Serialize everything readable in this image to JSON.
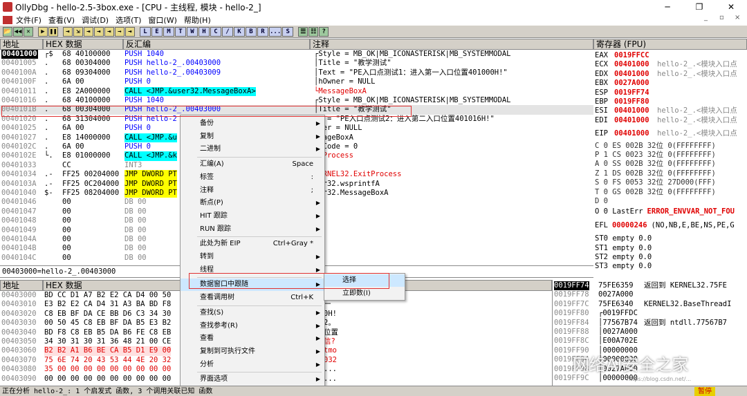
{
  "window": {
    "title": "OllyDbg - hello-2.5-3box.exe - [CPU - 主线程, 模块 - hello-2_]",
    "min": "─",
    "max": "❐",
    "close": "✕"
  },
  "menubar": {
    "items": [
      "文件(F)",
      "查看(V)",
      "调试(D)",
      "选项(T)",
      "窗口(W)",
      "帮助(H)"
    ],
    "mdi_min": "_",
    "mdi_restore": "▫",
    "mdi_close": "×"
  },
  "toolbar": {
    "buttons": [
      "📂",
      "◀◀",
      "✕",
      "▶",
      "❚❚",
      "⇥",
      "⇲",
      "⇥",
      "⇥",
      "⇥",
      "→",
      "⇥",
      "L",
      "E",
      "M",
      "T",
      "W",
      "H",
      "C",
      "/",
      "K",
      "B",
      "R",
      "...",
      "S",
      "☰",
      "☷",
      "?"
    ]
  },
  "disasm": {
    "headers": {
      "addr": "地址",
      "hex": "HEX 数据",
      "disasm": "反汇编",
      "comment": "注释"
    },
    "rows": [
      {
        "addr": "00401000",
        "mark": "┌$",
        "hex": "68 40100000",
        "ins": "PUSH 1040",
        "cmt": "┌Style = MB_OK|MB_ICONASTERISK|MB_SYSTEMMODAL"
      },
      {
        "addr": "00401005",
        "mark": " .",
        "hex": "68 00304000",
        "ins": "PUSH hello-2_.00403000",
        "cmt": "│Title = \"教学测试\""
      },
      {
        "addr": "0040100A",
        "mark": " .",
        "hex": "68 09304000",
        "ins": "PUSH hello-2_.00403009",
        "cmt": "│Text = \"PE入口点测试1：进入第一入口位置401000H!\""
      },
      {
        "addr": "0040100F",
        "mark": " .",
        "hex": "6A 00",
        "ins": "PUSH 0",
        "cmt": "│hOwner = NULL"
      },
      {
        "addr": "00401011",
        "mark": " .",
        "hex": "E8 2A000000",
        "ins": "CALL <JMP.&user32.MessageBoxA>",
        "cmt": "└MessageBoxA"
      },
      {
        "addr": "00401016",
        "mark": " .",
        "hex": "68 40100000",
        "ins": "PUSH 1040",
        "cmt": "┌Style = MB_OK|MB_ICONASTERISK|MB_SYSTEMMODAL"
      },
      {
        "addr": "0040101B",
        "mark": " .",
        "hex": "68 00304000",
        "ins": "PUSH hello-2_.00403000",
        "cmt": "│Title = \"教学测试\""
      },
      {
        "addr": "00401020",
        "mark": " .",
        "hex": "68 31304000",
        "ins": "PUSH hello-2",
        "cmt": "xt = \"PE入口点测试2：进入第二入口位置401016H!\""
      },
      {
        "addr": "00401025",
        "mark": " .",
        "hex": "6A 00",
        "ins": "PUSH 0",
        "cmt": "wner = NULL"
      },
      {
        "addr": "00401027",
        "mark": " .",
        "hex": "E8 14000000",
        "ins": "CALL <JMP.&u",
        "cmt": "ssageBoxA"
      },
      {
        "addr": "0040102C",
        "mark": " .",
        "hex": "6A 00",
        "ins": "PUSH 0",
        "cmt": "itCode = 0"
      },
      {
        "addr": "0040102E",
        "mark": "└.",
        "hex": "E8 01000000",
        "ins": "CALL <JMP.&k",
        "cmt": "itProcess"
      },
      {
        "addr": "00401033",
        "mark": "  ",
        "hex": "CC",
        "ins": "INT3",
        "cmt": ""
      },
      {
        "addr": "00401034",
        "mark": " .-",
        "hex": "FF25 00204000",
        "ins": "JMP DWORD PT",
        "cmt": "KERNEL32.ExitProcess"
      },
      {
        "addr": "0040103A",
        "mark": " .-",
        "hex": "FF25 0C204000",
        "ins": "JMP DWORD PT",
        "cmt": "ser32.wsprintfA"
      },
      {
        "addr": "00401040",
        "mark": " $-",
        "hex": "FF25 08204000",
        "ins": "JMP DWORD PT",
        "cmt": "ser32.MessageBoxA"
      },
      {
        "addr": "00401046",
        "mark": "  ",
        "hex": "00",
        "ins": "DB 00",
        "cmt": ""
      },
      {
        "addr": "00401047",
        "mark": "  ",
        "hex": "00",
        "ins": "DB 00",
        "cmt": ""
      },
      {
        "addr": "00401048",
        "mark": "  ",
        "hex": "00",
        "ins": "DB 00",
        "cmt": ""
      },
      {
        "addr": "00401049",
        "mark": "  ",
        "hex": "00",
        "ins": "DB 00",
        "cmt": ""
      },
      {
        "addr": "0040104A",
        "mark": "  ",
        "hex": "00",
        "ins": "DB 00",
        "cmt": ""
      },
      {
        "addr": "0040104B",
        "mark": "  ",
        "hex": "00",
        "ins": "DB 00",
        "cmt": ""
      },
      {
        "addr": "0040104C",
        "mark": "  ",
        "hex": "00",
        "ins": "DB 00",
        "cmt": ""
      }
    ],
    "info": "00403000=hello-2_.00403000"
  },
  "registers": {
    "header": "寄存器 (FPU)",
    "rows": [
      {
        "n": "EAX",
        "v": "0019FFCC",
        "c": ""
      },
      {
        "n": "ECX",
        "v": "00401000",
        "c": "hello-2_.<模块入口点"
      },
      {
        "n": "EDX",
        "v": "00401000",
        "c": "hello-2_.<模块入口点"
      },
      {
        "n": "EBX",
        "v": "0027A000",
        "c": ""
      },
      {
        "n": "ESP",
        "v": "0019FF74",
        "c": ""
      },
      {
        "n": "EBP",
        "v": "0019FF80",
        "c": ""
      },
      {
        "n": "ESI",
        "v": "00401000",
        "c": "hello-2_.<模块入口点"
      },
      {
        "n": "EDI",
        "v": "00401000",
        "c": "hello-2_.<模块入口点"
      },
      {
        "n": "",
        "v": "",
        "c": ""
      },
      {
        "n": "EIP",
        "v": "00401000",
        "c": "hello-2_.<模块入口点"
      }
    ],
    "flags": [
      "C 0   ES 002B 32位 0(FFFFFFFF)",
      "P 1   CS 0023 32位 0(FFFFFFFF)",
      "A 0   SS 002B 32位 0(FFFFFFFF)",
      "Z 1   DS 002B 32位 0(FFFFFFFF)",
      "S 0   FS 0053 32位 27D000(FFF)",
      "T 0   GS 002B 32位 0(FFFFFFFF)",
      "D 0"
    ],
    "lasterr_label": "O 0   LastErr",
    "lasterr": "ERROR_ENVVAR_NOT_FOU",
    "efl_label": "EFL",
    "efl": "00000246",
    "efl_desc": "(NO,NB,E,BE,NS,PE,G",
    "fpu": [
      "ST0 empty 0.0",
      "ST1 empty 0.0",
      "ST2 empty 0.0",
      "ST3 empty 0.0"
    ]
  },
  "dump": {
    "headers": {
      "addr": "地址",
      "hex": "HEX 数据"
    },
    "rows": [
      {
        "a": "00403000",
        "h": "BD CC D1 A7 B2 E2 CA D4 00 50",
        "r": ""
      },
      {
        "a": "00403010",
        "h": "E3 B2 E2 CA D4 31 A3 BA BD F8",
        "r": "一"
      },
      {
        "a": "00403020",
        "h": "C8 EB BF DA CE BB D6 C3 34 30",
        "r": "0H!"
      },
      {
        "a": "00403030",
        "h": "00 50 45 C8 EB BF DA B5 E3 B2",
        "r": "2。"
      },
      {
        "a": "00403040",
        "h": "BD F8 C8 EB B5 DA B6 FE C8 EB",
        "r": "位置"
      },
      {
        "a": "00403050",
        "h": "34 30 31 30 31 36 48 21 00 CE",
        "r": "信?"
      },
      {
        "a": "00403060",
        "h": "B2 B2 A1 B6 BE CA B5 D1 E9 00",
        "r": "tmo"
      },
      {
        "a": "00403070",
        "h": "75 6E 74 20 43 53 44 4E 20 32",
        "r": "032"
      },
      {
        "a": "00403080",
        "h": "35 00 00 00 00 00 00 00 00 00",
        "r": "..."
      },
      {
        "a": "00403090",
        "h": "00 00 00 00 00 00 00 00 00 00",
        "r": "..."
      }
    ]
  },
  "stack": {
    "rows": [
      {
        "a": "0019FF74",
        "v": "75FE6359",
        "c": "返回到 KERNEL32.75FE"
      },
      {
        "a": "0019FF78",
        "v": "0027A000",
        "c": ""
      },
      {
        "a": "0019FF7C",
        "v": "75FE6340",
        "c": "KERNEL32.BaseThreadI"
      },
      {
        "a": "0019FF80",
        "v": "┌0019FFDC",
        "c": ""
      },
      {
        "a": "0019FF84",
        "v": "│77567B74",
        "c": "返回到 ntdll.77567B7"
      },
      {
        "a": "0019FF88",
        "v": "│0027A000",
        "c": ""
      },
      {
        "a": "0019FF8C",
        "v": "│E00A702E",
        "c": ""
      },
      {
        "a": "0019FF90",
        "v": "│00000000",
        "c": ""
      },
      {
        "a": "0019FF94",
        "v": "│00000000",
        "c": ""
      },
      {
        "a": "0019FF98",
        "v": "│0027A000",
        "c": ""
      },
      {
        "a": "0019FF9C",
        "v": "│00000000",
        "c": ""
      }
    ]
  },
  "context_menu": {
    "items": [
      {
        "label": "备份",
        "sc": "",
        "sub": true
      },
      {
        "label": "复制",
        "sc": "",
        "sub": true
      },
      {
        "label": "二进制",
        "sc": "",
        "sub": true
      },
      {
        "label": "汇编(A)",
        "sc": "Space",
        "sub": false
      },
      {
        "label": "标签",
        "sc": ":",
        "sub": false
      },
      {
        "label": "注释",
        "sc": ";",
        "sub": false
      },
      {
        "label": "断点(P)",
        "sc": "",
        "sub": true
      },
      {
        "label": "HIT 跟踪",
        "sc": "",
        "sub": true
      },
      {
        "label": "RUN 跟踪",
        "sc": "",
        "sub": true
      },
      {
        "label": "此处为新 EIP",
        "sc": "Ctrl+Gray *",
        "sub": false
      },
      {
        "label": "转到",
        "sc": "",
        "sub": true
      },
      {
        "label": "线程",
        "sc": "",
        "sub": true
      },
      {
        "label": "数据窗口中跟随",
        "sc": "",
        "sub": true
      },
      {
        "label": "查看调用树",
        "sc": "Ctrl+K",
        "sub": false
      },
      {
        "label": "查找(S)",
        "sc": "",
        "sub": true
      },
      {
        "label": "查找参考(R)",
        "sc": "",
        "sub": true
      },
      {
        "label": "查看",
        "sc": "",
        "sub": true
      },
      {
        "label": "复制到可执行文件",
        "sc": "",
        "sub": true
      },
      {
        "label": "分析",
        "sc": "",
        "sub": true
      },
      {
        "label": "界面选项",
        "sc": "",
        "sub": true
      }
    ],
    "arrow": "▶"
  },
  "submenu": {
    "items": [
      "选择",
      "立即数(I)"
    ]
  },
  "status": {
    "text": "正在分析 hello-2_: 1 个启发式 函数, 3 个调用关联已知 函数",
    "state": "暂停"
  },
  "watermark": {
    "text": "网络AI安全之家",
    "url": "https://blog.csdn.net/..."
  },
  "colors": {
    "highlight": "#cde8ff",
    "red_box": "#e03030",
    "yellow": "#ffff00",
    "cyan": "#00ffff",
    "status_pause": "#e8d000"
  }
}
